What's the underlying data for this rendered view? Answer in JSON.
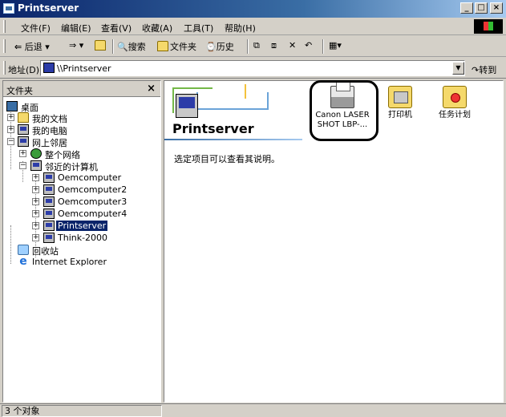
{
  "window": {
    "title": "Printserver"
  },
  "menu": [
    "文件(F)",
    "编辑(E)",
    "查看(V)",
    "收藏(A)",
    "工具(T)",
    "帮助(H)"
  ],
  "toolbar": {
    "back": "后退",
    "search": "搜索",
    "folders": "文件夹",
    "history": "历史"
  },
  "address": {
    "label": "地址(D)",
    "value": "\\\\Printserver",
    "go": "转到"
  },
  "folders_pane": {
    "title": "文件夹",
    "close": "×",
    "tree": [
      {
        "label": "桌面",
        "icon": "desktop-icon"
      },
      {
        "label": "我的文档",
        "icon": "folder-icon"
      },
      {
        "label": "我的电脑",
        "icon": "computer-icon"
      },
      {
        "label": "网上邻居",
        "icon": "network-icon"
      },
      {
        "label": "整个网络",
        "icon": "globe-icon"
      },
      {
        "label": "邻近的计算机",
        "icon": "computers-near-me-icon"
      },
      {
        "label": "Oemcomputer",
        "icon": "computer-icon"
      },
      {
        "label": "Oemcomputer2",
        "icon": "computer-icon"
      },
      {
        "label": "Oemcomputer3",
        "icon": "computer-icon"
      },
      {
        "label": "Oemcomputer4",
        "icon": "computer-icon"
      },
      {
        "label": "Printserver",
        "icon": "computer-icon",
        "selected": true
      },
      {
        "label": "Think-2000",
        "icon": "computer-icon"
      },
      {
        "label": "回收站",
        "icon": "recycle-bin-icon"
      },
      {
        "label": "Internet Explorer",
        "icon": "internet-explorer-icon"
      }
    ]
  },
  "content": {
    "heading": "Printserver",
    "description": "选定项目可以查看其说明。",
    "items": [
      {
        "label_line1": "Canon LASER",
        "label_line2": "SHOT LBP-...",
        "icon": "printer-icon",
        "highlighted": true
      },
      {
        "label_line1": "打印机",
        "label_line2": "",
        "icon": "printers-folder-icon"
      },
      {
        "label_line1": "任务计划",
        "label_line2": "",
        "icon": "scheduled-tasks-icon"
      }
    ]
  },
  "status": {
    "text": "3 个对象"
  }
}
